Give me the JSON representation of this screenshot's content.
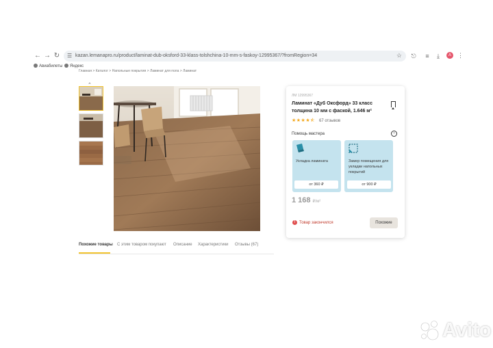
{
  "browser": {
    "url": "kazan.lemanapro.ru/product/laminat-dub-oksford-33-klass-tolshchina-10-mm-s-faskoy-12995367/?fromRegion=34",
    "bookmarks": [
      "Авиабилеты",
      "Яндекс"
    ],
    "profile_initial": "A"
  },
  "breadcrumb": "Главная > Каталог > Напольные покрытия > Ламинат для пола > Ламинат",
  "tabs": [
    {
      "label": "Похожие товары",
      "active": true
    },
    {
      "label": "С этим товаром покупают"
    },
    {
      "label": "Описание"
    },
    {
      "label": "Характеристики"
    },
    {
      "label": "Отзывы (67)"
    }
  ],
  "product": {
    "sku": "ЛМ 12995367",
    "title": "Ламинат «Дуб Оксфорд» 33 класс толщина 10 мм с фаской, 1.646 м²",
    "stars": "★★★★⯪",
    "reviews": "67 отзывов",
    "help_title": "Помощь мастера",
    "services": [
      {
        "label": "Укладка ламината",
        "price": "от 360 ₽"
      },
      {
        "label": "Замер помещения для укладки напольных покрытий",
        "price": "от 900 ₽"
      }
    ],
    "price": "1 168",
    "unit": "₽/м²",
    "status": "Товар закончился",
    "similar_button": "Похожие"
  },
  "watermark": "Avito",
  "colors": {
    "accent": "#f2c42e",
    "service_bg": "#c4e3ee",
    "out_of_stock": "#e05050"
  }
}
